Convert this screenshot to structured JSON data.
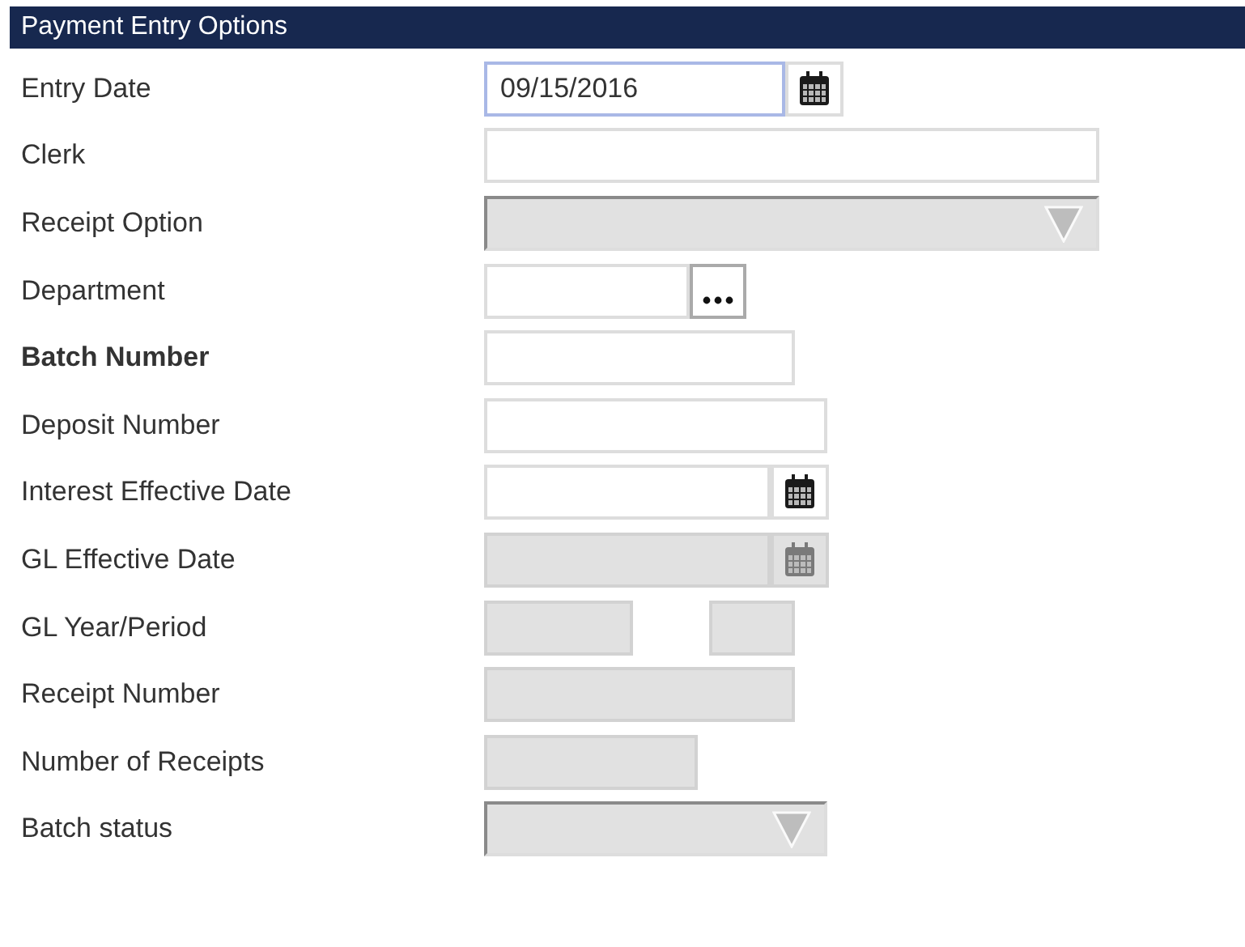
{
  "header": {
    "title": "Payment Entry Options"
  },
  "fields": [
    {
      "label": "Entry Date",
      "kind": "date",
      "value": "09/15/2016",
      "disabled": false,
      "focused": true,
      "bold": false
    },
    {
      "label": "Clerk",
      "kind": "text",
      "disabled": false,
      "bold": false
    },
    {
      "label": "Receipt Option",
      "kind": "select",
      "disabled": true,
      "bold": false
    },
    {
      "label": "Department",
      "kind": "lookup",
      "disabled": false,
      "bold": false
    },
    {
      "label": "Batch Number",
      "kind": "text",
      "disabled": false,
      "bold": true
    },
    {
      "label": "Deposit Number",
      "kind": "text",
      "disabled": false,
      "bold": false
    },
    {
      "label": "Interest Effective Date",
      "kind": "date",
      "disabled": false,
      "focused": false,
      "bold": false
    },
    {
      "label": "GL Effective Date",
      "kind": "date",
      "disabled": true,
      "focused": false,
      "bold": false
    },
    {
      "label": "GL Year/Period",
      "kind": "pair",
      "disabled": true,
      "bold": false
    },
    {
      "label": "Receipt Number",
      "kind": "text",
      "disabled": true,
      "bold": false
    },
    {
      "label": "Number of Receipts",
      "kind": "text",
      "disabled": true,
      "bold": false
    },
    {
      "label": "Batch status",
      "kind": "select",
      "disabled": true,
      "bold": false
    }
  ]
}
